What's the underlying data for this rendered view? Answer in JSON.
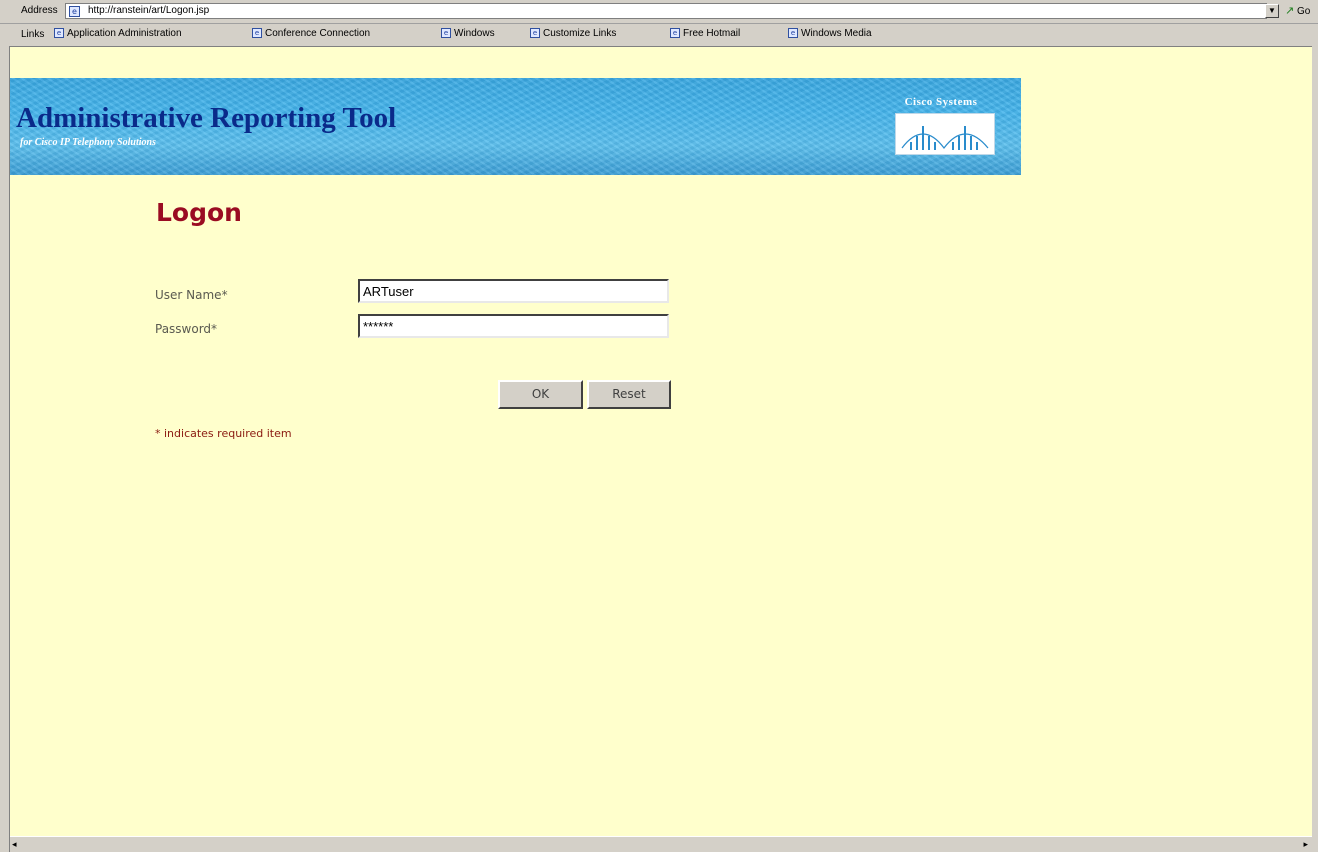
{
  "browser": {
    "address_label": "Address",
    "url": "http://ranstein/art/Logon.jsp",
    "go_label": "Go",
    "links_label": "Links",
    "links": [
      "Application Administration",
      "Conference Connection",
      "Windows",
      "Customize Links",
      "Free Hotmail",
      "Windows Media"
    ]
  },
  "banner": {
    "title": "Administrative Reporting Tool",
    "subtitle": "for Cisco IP Telephony Solutions",
    "logo_text": "Cisco Systems"
  },
  "logon": {
    "heading": "Logon",
    "username_label": "User Name*",
    "username_value": "ARTuser",
    "password_label": "Password*",
    "password_value": "******",
    "ok_label": "OK",
    "reset_label": "Reset",
    "required_note": "* indicates required item"
  },
  "colors": {
    "page_background": "#ffffcc",
    "heading": "#9a0c22",
    "banner_blue": "#45b5ec"
  }
}
